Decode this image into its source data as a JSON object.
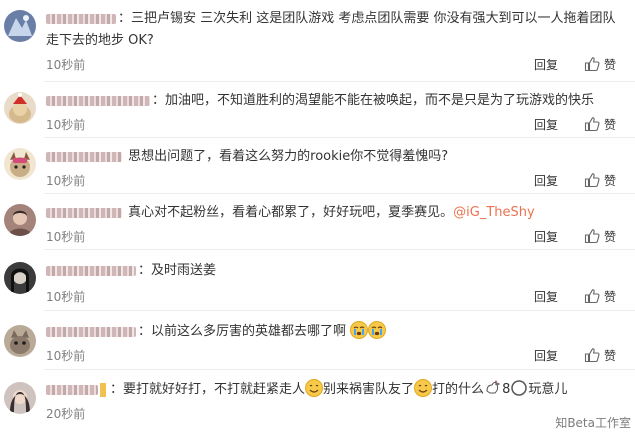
{
  "comments": [
    {
      "lines": [
        "三把卢锡安 三次失利 这是团队游戏 考虑点团队需要 你没有强大到可以一人拖着团队",
        "走下去的地步 OK?"
      ],
      "time": "10秒前",
      "reply": "回复",
      "like": "赞",
      "avatar_color": "#6a7fa6"
    },
    {
      "lines": [
        "加油吧，不知道胜利的渴望能不能在被唤起，而不是只是为了玩游戏的快乐"
      ],
      "time": "10秒前",
      "reply": "回复",
      "like": "赞",
      "avatar_color": "#d8c6a4"
    },
    {
      "lines": [
        "思想出问题了，看着这么努力的rookie你不觉得羞愧吗?"
      ],
      "time": "10秒前",
      "reply": "回复",
      "like": "赞",
      "avatar_color": "#c9ad86"
    },
    {
      "lines": [
        "真心对不起粉丝，看着心都累了，好好玩吧，夏季赛见。"
      ],
      "mention": "@iG_TheShy",
      "time": "10秒前",
      "reply": "回复",
      "like": "赞",
      "avatar_color": "#a3837a"
    },
    {
      "lines": [
        "及时雨送姜"
      ],
      "time": "10秒前",
      "reply": "回复",
      "like": "赞",
      "avatar_color": "#3b3b3b"
    },
    {
      "lines": [
        "以前这么多厉害的英雄都去哪了啊"
      ],
      "time": "10秒前",
      "reply": "回复",
      "like": "赞",
      "avatar_color": "#8c7b6d"
    },
    {
      "lines": [
        "要打就好好打，不打就赶紧走人",
        "别来祸害队友了",
        "打的什么",
        "8",
        "玩意儿"
      ],
      "time": "20秒前",
      "avatar_color": "#5a4f52"
    }
  ],
  "watermark": "知Beta工作室",
  "colors": {
    "mention": "#eb7350",
    "time": "#808080",
    "divider": "#ececec"
  }
}
